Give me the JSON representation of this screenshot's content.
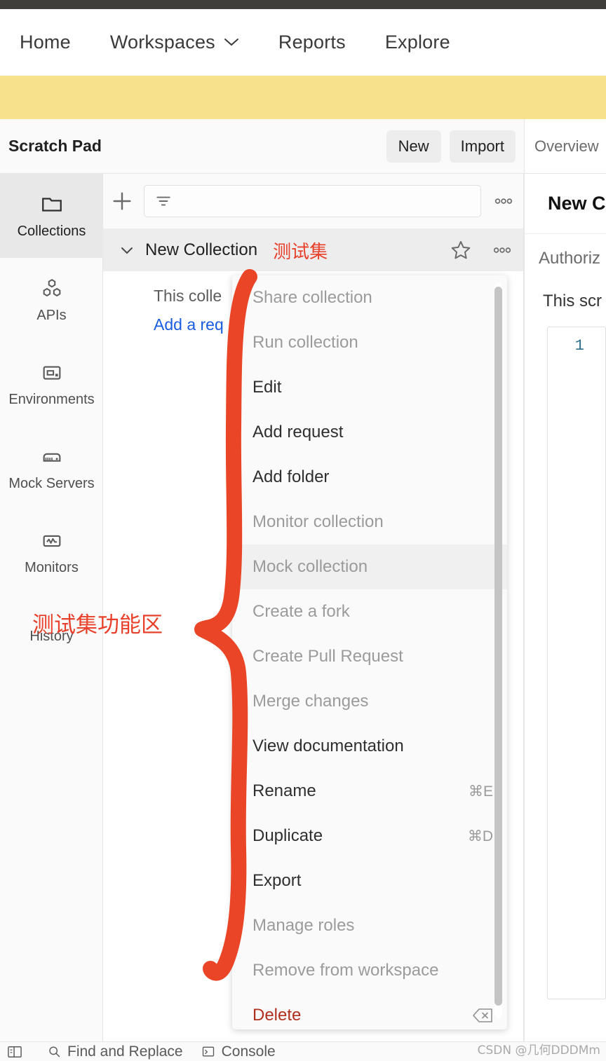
{
  "app": {
    "accent_red": "#e8402a",
    "banner_color": "#f7e18c",
    "link_blue": "#1a5ce0",
    "danger_red": "#b0301d"
  },
  "main_nav": {
    "items": [
      {
        "label": "Home",
        "has_chevron": false
      },
      {
        "label": "Workspaces",
        "has_chevron": true
      },
      {
        "label": "Reports",
        "has_chevron": false
      },
      {
        "label": "Explore",
        "has_chevron": false
      }
    ]
  },
  "workspace_header": {
    "title": "Scratch Pad",
    "new_label": "New",
    "import_label": "Import"
  },
  "tabstrip": {
    "tabs": [
      {
        "label": "Overview"
      }
    ]
  },
  "sidebar_rail": {
    "items": [
      {
        "label": "Collections",
        "icon": "folder-icon",
        "active": true
      },
      {
        "label": "APIs",
        "icon": "apis-icon",
        "active": false
      },
      {
        "label": "Environments",
        "icon": "environments-icon",
        "active": false
      },
      {
        "label": "Mock Servers",
        "icon": "mock-servers-icon",
        "active": false
      },
      {
        "label": "Monitors",
        "icon": "monitors-icon",
        "active": false
      },
      {
        "label": "History",
        "icon": "history-icon",
        "active": false
      }
    ]
  },
  "collections_panel": {
    "toolbar": {
      "add_icon": "plus-icon",
      "filter_icon": "filter-icon",
      "filter_placeholder": "",
      "more_icon": "ellipsis-icon"
    },
    "collection": {
      "chevron_icon": "chevron-down-icon",
      "name": "New Collection",
      "annotation_cn": "测试集",
      "star_icon": "star-icon",
      "more_icon": "ellipsis-icon"
    },
    "empty_state": {
      "text": "This colle",
      "link": "Add a req"
    }
  },
  "context_menu": {
    "items": [
      {
        "label": "Share collection",
        "disabled": true,
        "shortcut": "",
        "highlight": false,
        "danger": false
      },
      {
        "label": "Run collection",
        "disabled": true,
        "shortcut": "",
        "highlight": false,
        "danger": false
      },
      {
        "label": "Edit",
        "disabled": false,
        "shortcut": "",
        "highlight": false,
        "danger": false
      },
      {
        "label": "Add request",
        "disabled": false,
        "shortcut": "",
        "highlight": false,
        "danger": false
      },
      {
        "label": "Add folder",
        "disabled": false,
        "shortcut": "",
        "highlight": false,
        "danger": false
      },
      {
        "label": "Monitor collection",
        "disabled": true,
        "shortcut": "",
        "highlight": false,
        "danger": false
      },
      {
        "label": "Mock collection",
        "disabled": true,
        "shortcut": "",
        "highlight": true,
        "danger": false
      },
      {
        "label": "Create a fork",
        "disabled": true,
        "shortcut": "",
        "highlight": false,
        "danger": false
      },
      {
        "label": "Create Pull Request",
        "disabled": true,
        "shortcut": "",
        "highlight": false,
        "danger": false
      },
      {
        "label": "Merge changes",
        "disabled": true,
        "shortcut": "",
        "highlight": false,
        "danger": false
      },
      {
        "label": "View documentation",
        "disabled": false,
        "shortcut": "",
        "highlight": false,
        "danger": false
      },
      {
        "label": "Rename",
        "disabled": false,
        "shortcut": "⌘E",
        "highlight": false,
        "danger": false
      },
      {
        "label": "Duplicate",
        "disabled": false,
        "shortcut": "⌘D",
        "highlight": false,
        "danger": false
      },
      {
        "label": "Export",
        "disabled": false,
        "shortcut": "",
        "highlight": false,
        "danger": false
      },
      {
        "label": "Manage roles",
        "disabled": true,
        "shortcut": "",
        "highlight": false,
        "danger": false
      },
      {
        "label": "Remove from workspace",
        "disabled": true,
        "shortcut": "",
        "highlight": false,
        "danger": false
      },
      {
        "label": "Delete",
        "disabled": false,
        "shortcut": "",
        "highlight": false,
        "danger": true,
        "shortcut_icon": "backspace-icon"
      }
    ]
  },
  "detail_pane": {
    "title": "New Co",
    "tabs_text": "Authoriz",
    "description": "This scr",
    "code_line_number": "1"
  },
  "annotation": {
    "region_label": "测试集功能区"
  },
  "status_bar": {
    "items": [
      {
        "label": "",
        "icon": "sidebar-toggle-icon"
      },
      {
        "label": "Find and Replace",
        "icon": "search-icon"
      },
      {
        "label": "Console",
        "icon": "console-icon"
      }
    ]
  },
  "watermark": {
    "text": "CSDN @几何DDDMm"
  }
}
